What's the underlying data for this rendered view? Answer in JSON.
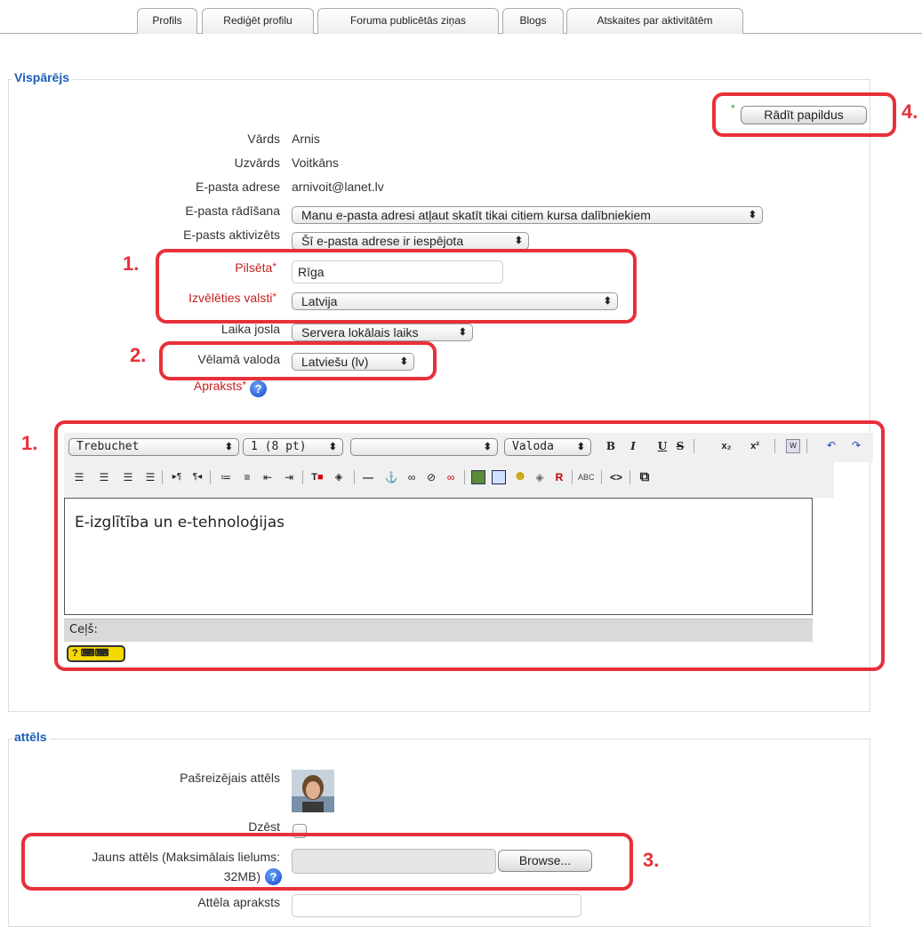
{
  "tabs": [
    "Profils",
    "Rediģēt profilu",
    "Foruma publicētās ziņas",
    "Blogs",
    "Atskaites par aktivitātēm"
  ],
  "general": {
    "legend": "Vispārējs",
    "show_more_button": "Rādīt papildus",
    "name_label": "Vārds",
    "name_value": "Arnis",
    "surname_label": "Uzvārds",
    "surname_value": "Voitkāns",
    "email_label": "E-pasta adrese",
    "email_value": "arnivoit@lanet.lv",
    "email_display_label": "E-pasta rādīšana",
    "email_display_value": "Manu e-pasta adresi atļaut skatīt tikai citiem kursa dalībniekiem",
    "email_enabled_label": "E-pasts aktivizēts",
    "email_enabled_value": "Šī e-pasta adrese ir iespējota",
    "city_label": "Pilsēta",
    "city_value": "Rīga",
    "country_label": "Izvēlēties valsti",
    "country_value": "Latvija",
    "timezone_label": "Laika josla",
    "timezone_value": "Servera lokālais laiks",
    "language_label": "Vēlamā valoda",
    "language_value": "Latviešu (lv)",
    "description_label": "Apraksts"
  },
  "editor": {
    "font_family": "Trebuchet",
    "font_size": "1 (8 pt)",
    "heading": "",
    "language": "Valoda",
    "content": "E-izglītība un e-tehnoloģijas",
    "path_label": "Ceļš:"
  },
  "picture": {
    "legend": "attēls",
    "current_label": "Pašreizējais attēls",
    "delete_label": "Dzēst",
    "new_label_line1": "Jauns attēls (Maksimālais lielums:",
    "new_label_line2": "32MB)",
    "browse_button": "Browse...",
    "description_label": "Attēla apraksts"
  },
  "annotations": [
    "1.",
    "2.",
    "1.",
    "3.",
    "4."
  ],
  "colors": {
    "annotation_red": "#e8303a",
    "legend_blue": "#1a5eb8",
    "required_red": "#c42020"
  }
}
